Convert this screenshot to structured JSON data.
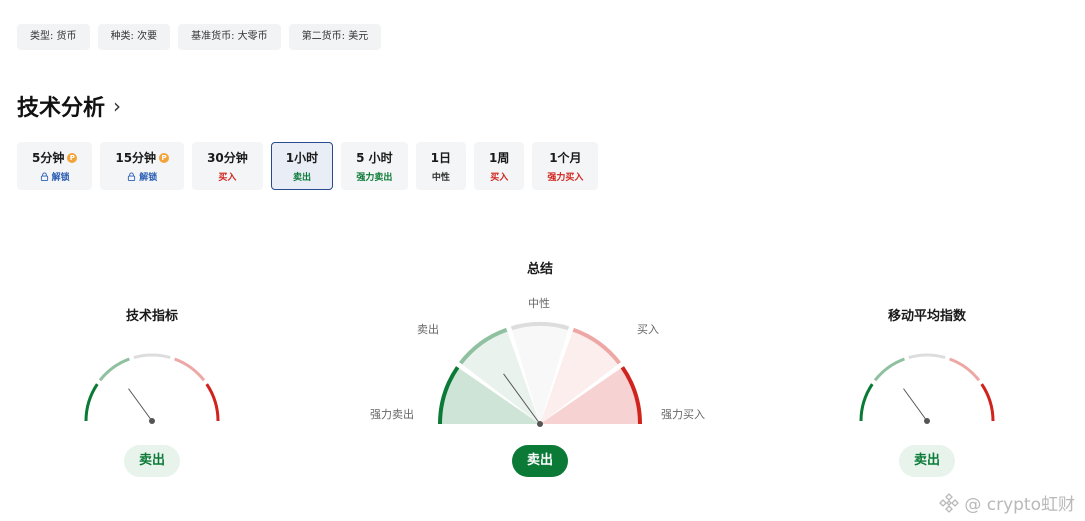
{
  "tags": [
    "类型: 货币",
    "种类: 次要",
    "基准货币: 大零币",
    "第二货币: 美元"
  ],
  "section_title": "技术分析",
  "periods": [
    {
      "label": "5分钟",
      "status": "解锁",
      "pro": true,
      "locked": true,
      "active": false,
      "tone": "unlock"
    },
    {
      "label": "15分钟",
      "status": "解锁",
      "pro": true,
      "locked": true,
      "active": false,
      "tone": "unlock"
    },
    {
      "label": "30分钟",
      "status": "买入",
      "pro": false,
      "locked": false,
      "active": false,
      "tone": "buy"
    },
    {
      "label": "1小时",
      "status": "卖出",
      "pro": false,
      "locked": false,
      "active": true,
      "tone": "sell"
    },
    {
      "label": "5 小时",
      "status": "强力卖出",
      "pro": false,
      "locked": false,
      "active": false,
      "tone": "strong-sell"
    },
    {
      "label": "1日",
      "status": "中性",
      "pro": false,
      "locked": false,
      "active": false,
      "tone": "neutral"
    },
    {
      "label": "1周",
      "status": "买入",
      "pro": false,
      "locked": false,
      "active": false,
      "tone": "buy"
    },
    {
      "label": "1个月",
      "status": "强力买入",
      "pro": false,
      "locked": false,
      "active": false,
      "tone": "strong-buy"
    }
  ],
  "pro_badge": "P",
  "gauges": {
    "left": {
      "title": "技术指标",
      "result": "卖出",
      "level": 0.3
    },
    "center": {
      "title": "总结",
      "result": "卖出",
      "level": 0.3,
      "labels": {
        "strong_sell": "强力卖出",
        "sell": "卖出",
        "neutral": "中性",
        "buy": "买入",
        "strong_buy": "强力买入"
      }
    },
    "right": {
      "title": "移动平均指数",
      "result": "卖出",
      "level": 0.3
    }
  },
  "colors": {
    "strong_sell": "#0b7a37",
    "sell": "#8fc0a0",
    "neutral": "#dddddd",
    "buy": "#eda8a5",
    "strong_buy": "#d1231d",
    "needle": "#555555"
  },
  "watermark": "@ crypto虹财"
}
